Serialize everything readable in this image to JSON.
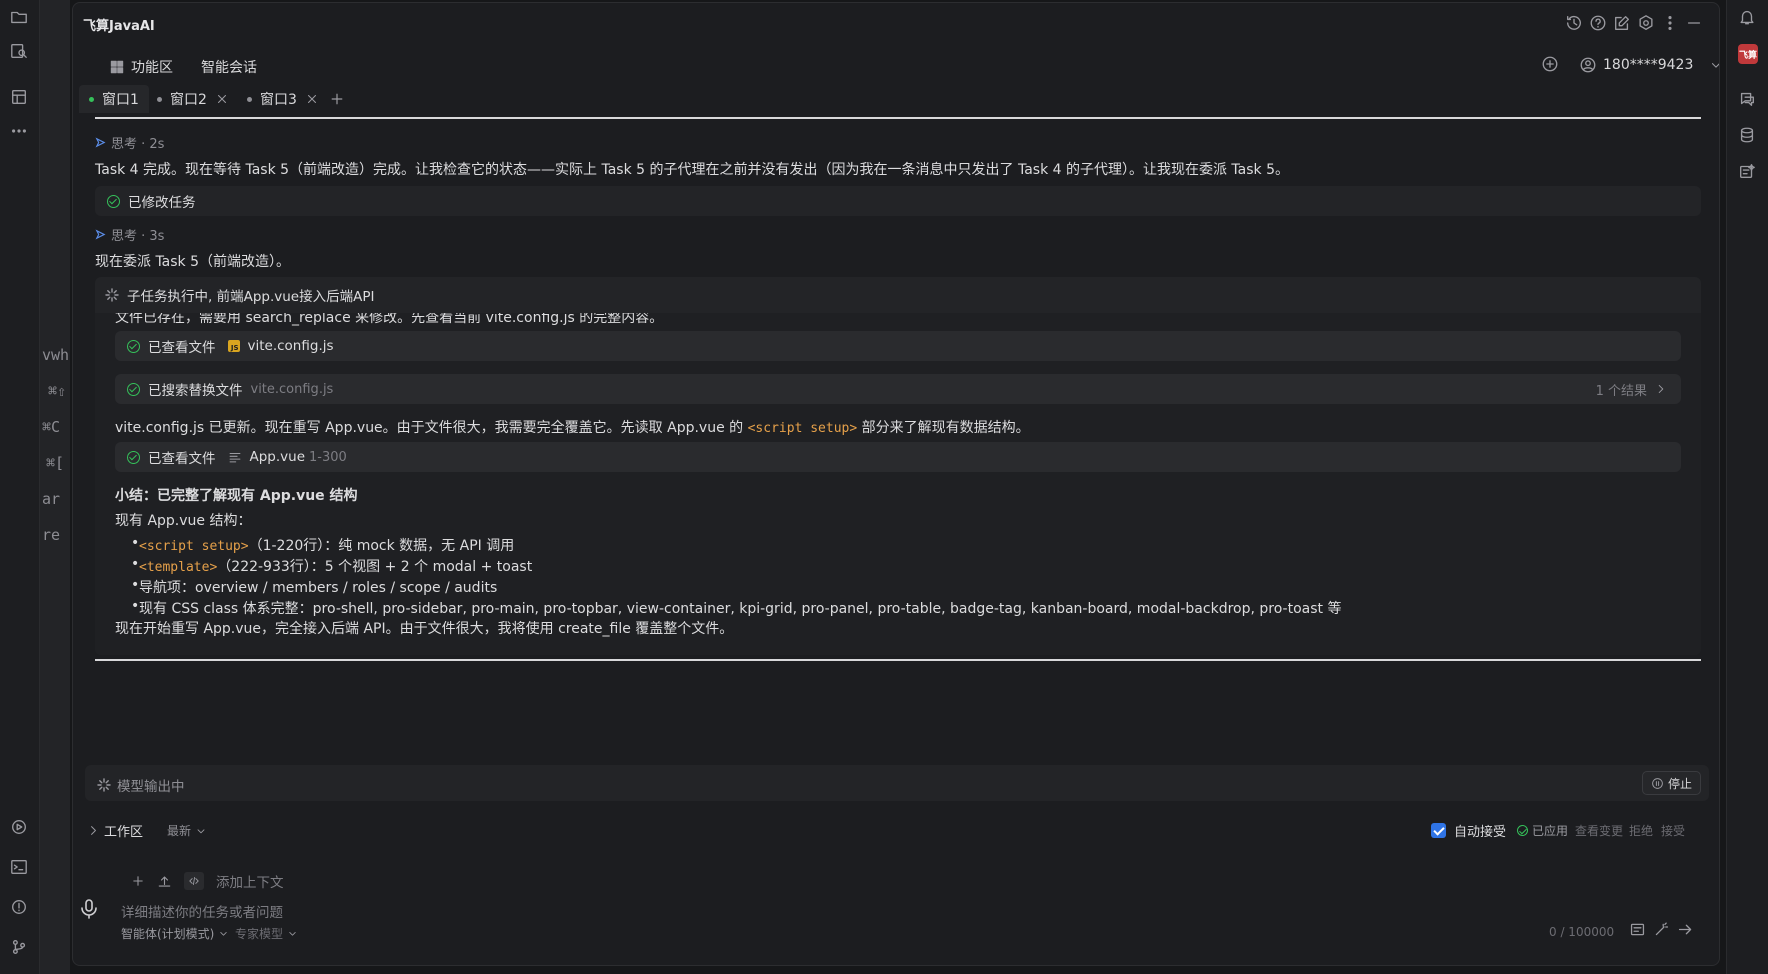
{
  "app": {
    "title": "飞算JavaAI",
    "logo_text": "飞算"
  },
  "editor_fragments": [
    "vwh",
    "⌘⇧",
    "⌘C",
    "⌘[",
    "ar",
    "re t"
  ],
  "nav": {
    "feature_area": "功能区",
    "smart_chat": "智能会话",
    "user": "180****9423"
  },
  "tabs": [
    {
      "label": "窗口1",
      "active": true
    },
    {
      "label": "窗口2",
      "active": false
    },
    {
      "label": "窗口3",
      "active": false
    }
  ],
  "chat": {
    "think1": "思考 · 2s",
    "msg1": "Task 4 完成。现在等待 Task 5（前端改造）完成。让我检查它的状态——实际上 Task 5 的子代理在之前并没有发出（因为我在一条消息中只发出了 Task 4 的子代理）。让我现在委派 Task 5。",
    "task_modified": "已修改任务",
    "think2": "思考 · 3s",
    "msg2": "现在委派 Task 5（前端改造）。",
    "subtask_title": "子任务执行中, 前端App.vue接入后端API",
    "clipped_line": "文件已存在，需要用 search_replace 来修改。先查看当前 vite.config.js 的完整内容。",
    "viewed_file_label": "已查看文件",
    "viewed_file_name": "vite.config.js",
    "replace_label": "已搜索替换文件",
    "replace_file": "vite.config.js",
    "replace_result": "1 个结果",
    "msg3_pre": "vite.config.js 已更新。现在重写 App.vue。由于文件很大，我需要完全覆盖它。先读取 App.vue 的",
    "msg3_code": "<script setup>",
    "msg3_post": "部分来了解现有数据结构。",
    "viewed_file2_label": "已查看文件",
    "viewed_file2_name": "App.vue",
    "viewed_file2_range": "1-300",
    "summary_title": "小结：已完整了解现有 App.vue 结构",
    "summary_intro": "现有 App.vue 结构：",
    "bullets": [
      {
        "code": "<script setup>",
        "text": "（1-220行）：纯 mock 数据，无 API 调用"
      },
      {
        "code": "<template>",
        "text": "（222-933行）：5 个视图 + 2 个 modal + toast"
      },
      {
        "code": "",
        "text": "导航项：overview / members / roles / scope / audits"
      },
      {
        "code": "",
        "text": "现有 CSS class 体系完整：pro-shell, pro-sidebar, pro-main, pro-topbar, view-container, kpi-grid, pro-panel, pro-table, badge-tag, kanban-board, modal-backdrop, pro-toast 等"
      }
    ],
    "closing": "现在开始重写 App.vue，完全接入后端 API。由于文件很大，我将使用 create_file 覆盖整个文件。"
  },
  "status": {
    "text": "模型输出中",
    "stop": "停止"
  },
  "workspace": {
    "label": "工作区",
    "latest": "最新",
    "auto_accept": "自动接受",
    "applied": "已应用",
    "view_changes": "查看变更",
    "reject": "拒绝",
    "accept": "接受"
  },
  "input": {
    "add_context": "添加上下文",
    "placeholder": "详细描述你的任务或者问题",
    "agent_mode": "智能体(计划模式)",
    "model": "专家模型",
    "counter": "0 / 100000"
  },
  "colors": {
    "accent_green": "#35c15a",
    "code_orange": "#e5a04a",
    "checkbox_blue": "#2f74e6",
    "brand_red": "#c0393b"
  }
}
